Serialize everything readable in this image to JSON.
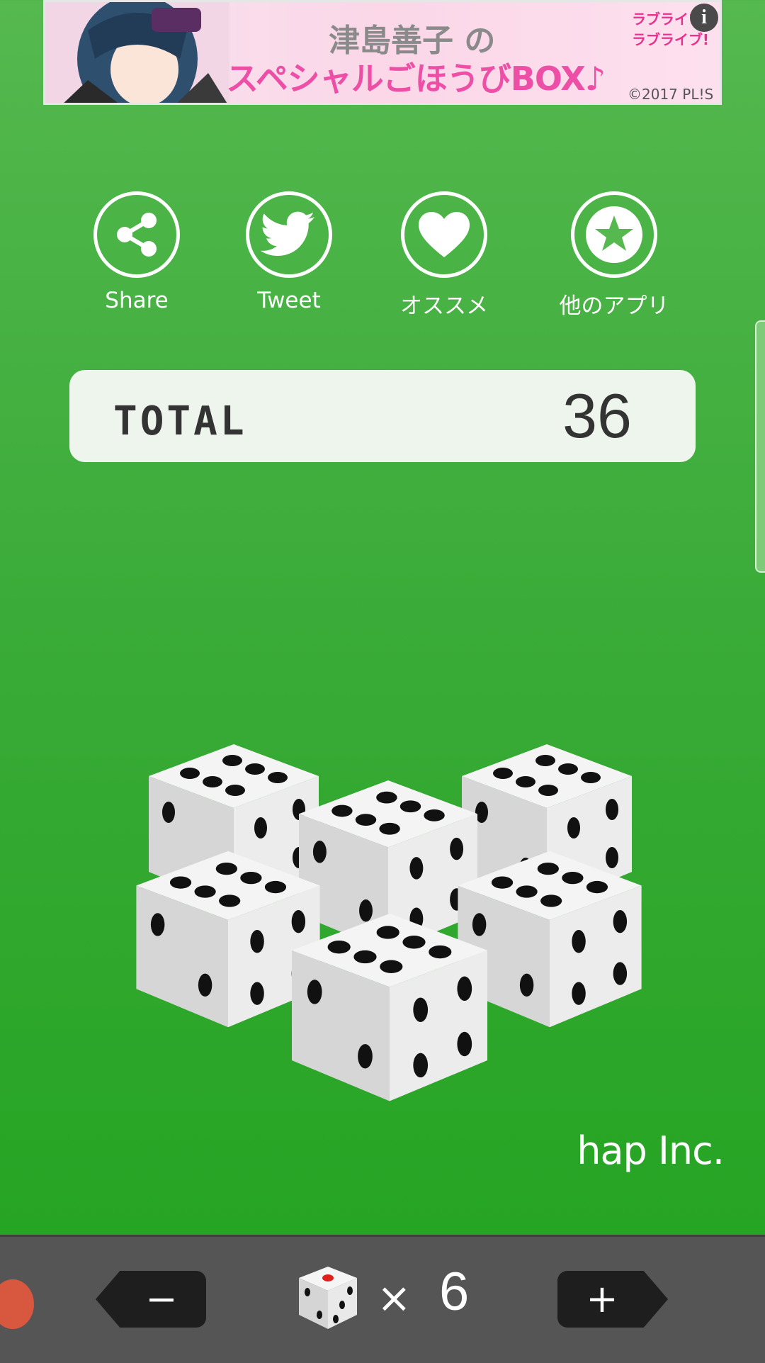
{
  "ad": {
    "title_line": "津島善子 の",
    "subtitle_line": "スペシャルごほうびBOX♪",
    "logo_text": "ラブライブ!",
    "copyright": "©2017 PL!S",
    "info_icon": "info-icon"
  },
  "actions": [
    {
      "label": "Share",
      "icon": "share-icon"
    },
    {
      "label": "Tweet",
      "icon": "twitter-bird-icon"
    },
    {
      "label": "オススメ",
      "icon": "heart-icon"
    },
    {
      "label": "他のアプリ",
      "icon": "star-icon"
    }
  ],
  "total": {
    "label": "TOTAL",
    "value": "36"
  },
  "dice": {
    "count": 6,
    "faces": [
      6,
      6,
      6,
      6,
      6,
      6
    ]
  },
  "brand": "hap Inc.",
  "controls": {
    "minus_label": "−",
    "plus_label": "+",
    "times_symbol": "×",
    "dice_count": "6"
  },
  "colors": {
    "background": "#3aab38",
    "bar": "#555555",
    "total_panel": "#eef5ec"
  }
}
